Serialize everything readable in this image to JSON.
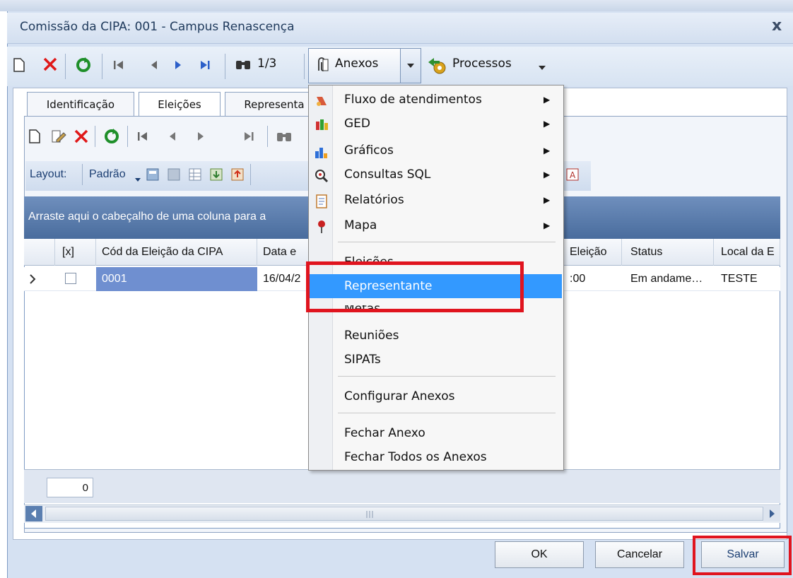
{
  "window": {
    "title": "Comissão da CIPA: 001 - Campus Renascença",
    "close_glyph": "x"
  },
  "toolbar": {
    "record_counter": "1/3",
    "anexos_label": "Anexos",
    "processos_label": "Processos"
  },
  "tabs": [
    {
      "label": "Identificação"
    },
    {
      "label": "Eleições"
    },
    {
      "label": "Representa"
    }
  ],
  "layout_bar": {
    "label": "Layout:",
    "selected": "Padrão"
  },
  "grid": {
    "group_hint": "Arraste aqui o cabeçalho de uma coluna para a",
    "columns": [
      "[x]",
      "Cód da Eleição da CIPA",
      "Data e",
      "Eleição",
      "Status",
      "Local da E"
    ],
    "row": {
      "codigo": "0001",
      "data": "16/04/2",
      "hora": ":00",
      "status": "Em andame…",
      "local": "TESTE"
    },
    "footer_count": "0"
  },
  "menu": {
    "items_submenu": [
      {
        "label": "Fluxo de atendimentos",
        "icon": "flow-icon"
      },
      {
        "label": "GED",
        "icon": "ged-icon"
      },
      {
        "label": "Gráficos",
        "icon": "chart-icon"
      },
      {
        "label": "Consultas SQL",
        "icon": "sql-query-icon"
      },
      {
        "label": "Relatórios",
        "icon": "report-icon"
      },
      {
        "label": "Mapa",
        "icon": "map-pin-icon"
      }
    ],
    "items_attachments": [
      "Eleições",
      "Representante",
      "Metas",
      "Reuniões",
      "SIPATs"
    ],
    "configure": "Configurar Anexos",
    "close_one": "Fechar Anexo",
    "close_all": "Fechar Todos os Anexos"
  },
  "buttons": {
    "ok": "OK",
    "cancel": "Cancelar",
    "save": "Salvar"
  },
  "colors": {
    "highlight": "#3399ff",
    "annotation_red": "#e0141e",
    "grid_header_blue": "#496c9d"
  }
}
